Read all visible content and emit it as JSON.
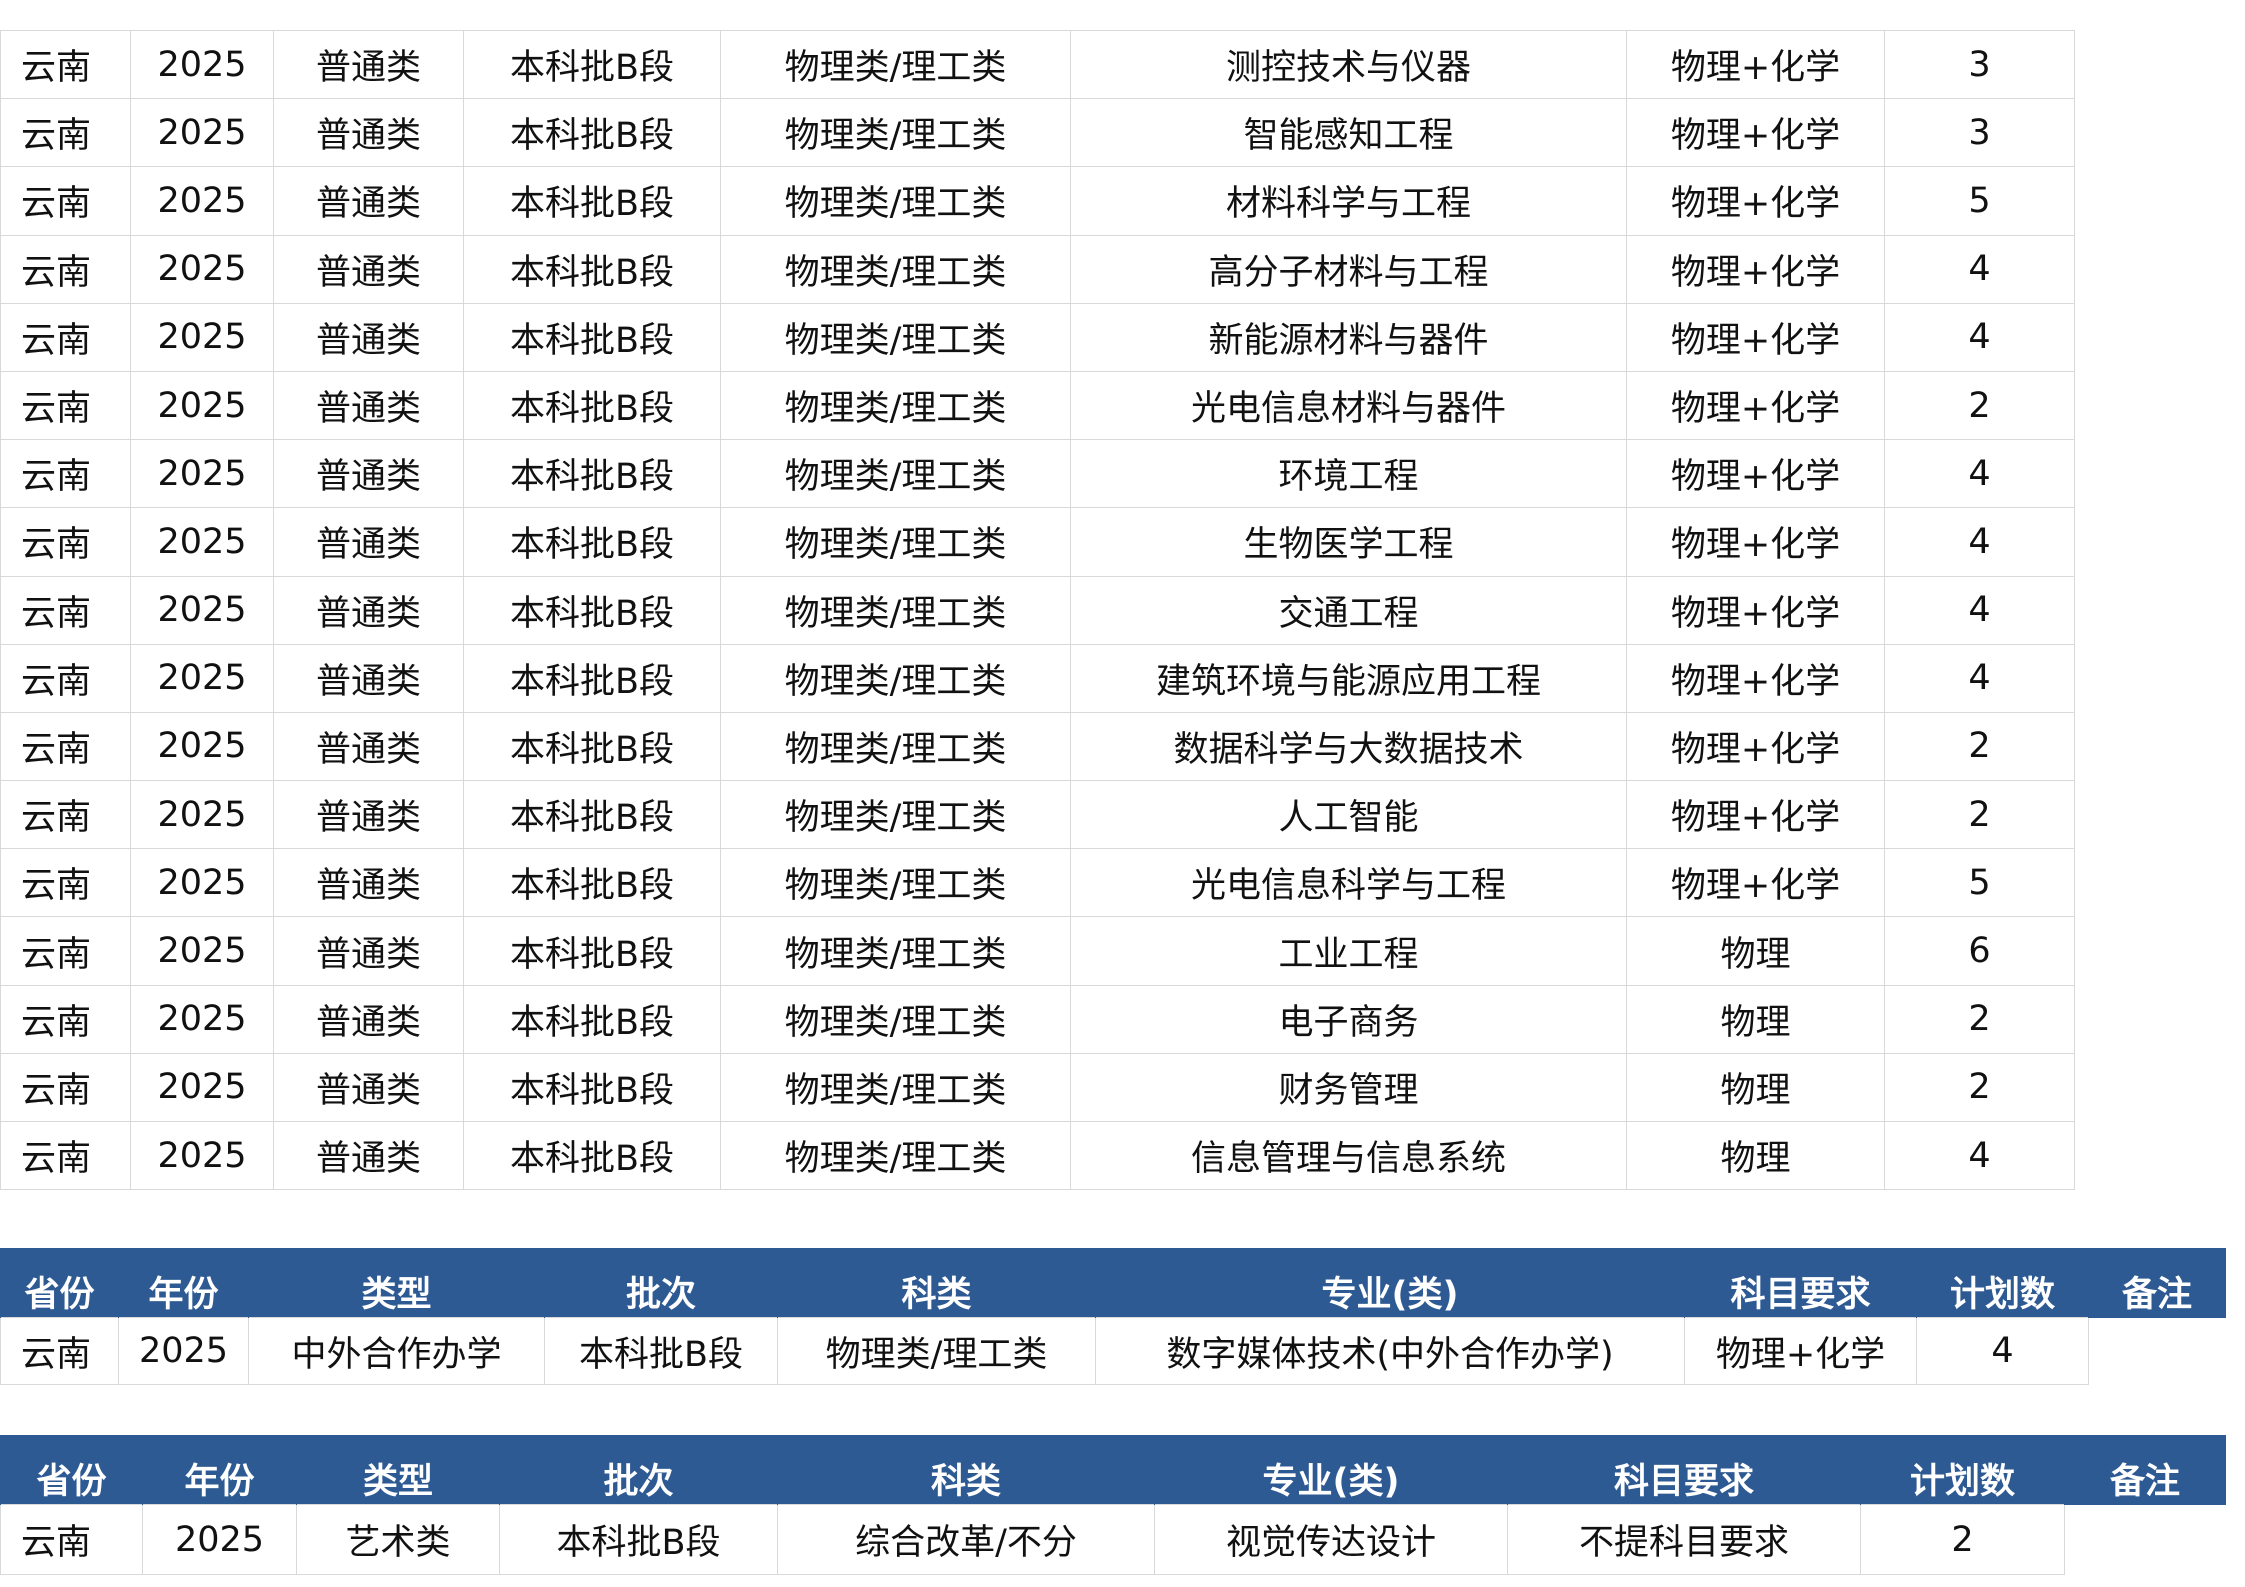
{
  "main_table": {
    "rows": [
      [
        "云南",
        "2025",
        "普通类",
        "本科批B段",
        "物理类/理工类",
        "测控技术与仪器",
        "物理+化学",
        "3"
      ],
      [
        "云南",
        "2025",
        "普通类",
        "本科批B段",
        "物理类/理工类",
        "智能感知工程",
        "物理+化学",
        "3"
      ],
      [
        "云南",
        "2025",
        "普通类",
        "本科批B段",
        "物理类/理工类",
        "材料科学与工程",
        "物理+化学",
        "5"
      ],
      [
        "云南",
        "2025",
        "普通类",
        "本科批B段",
        "物理类/理工类",
        "高分子材料与工程",
        "物理+化学",
        "4"
      ],
      [
        "云南",
        "2025",
        "普通类",
        "本科批B段",
        "物理类/理工类",
        "新能源材料与器件",
        "物理+化学",
        "4"
      ],
      [
        "云南",
        "2025",
        "普通类",
        "本科批B段",
        "物理类/理工类",
        "光电信息材料与器件",
        "物理+化学",
        "2"
      ],
      [
        "云南",
        "2025",
        "普通类",
        "本科批B段",
        "物理类/理工类",
        "环境工程",
        "物理+化学",
        "4"
      ],
      [
        "云南",
        "2025",
        "普通类",
        "本科批B段",
        "物理类/理工类",
        "生物医学工程",
        "物理+化学",
        "4"
      ],
      [
        "云南",
        "2025",
        "普通类",
        "本科批B段",
        "物理类/理工类",
        "交通工程",
        "物理+化学",
        "4"
      ],
      [
        "云南",
        "2025",
        "普通类",
        "本科批B段",
        "物理类/理工类",
        "建筑环境与能源应用工程",
        "物理+化学",
        "4"
      ],
      [
        "云南",
        "2025",
        "普通类",
        "本科批B段",
        "物理类/理工类",
        "数据科学与大数据技术",
        "物理+化学",
        "2"
      ],
      [
        "云南",
        "2025",
        "普通类",
        "本科批B段",
        "物理类/理工类",
        "人工智能",
        "物理+化学",
        "2"
      ],
      [
        "云南",
        "2025",
        "普通类",
        "本科批B段",
        "物理类/理工类",
        "光电信息科学与工程",
        "物理+化学",
        "5"
      ],
      [
        "云南",
        "2025",
        "普通类",
        "本科批B段",
        "物理类/理工类",
        "工业工程",
        "物理",
        "6"
      ],
      [
        "云南",
        "2025",
        "普通类",
        "本科批B段",
        "物理类/理工类",
        "电子商务",
        "物理",
        "2"
      ],
      [
        "云南",
        "2025",
        "普通类",
        "本科批B段",
        "物理类/理工类",
        "财务管理",
        "物理",
        "2"
      ],
      [
        "云南",
        "2025",
        "普通类",
        "本科批B段",
        "物理类/理工类",
        "信息管理与信息系统",
        "物理",
        "4"
      ]
    ]
  },
  "coop_table": {
    "headers": [
      "省份",
      "年份",
      "类型",
      "批次",
      "科类",
      "专业(类)",
      "科目要求",
      "计划数",
      "备注"
    ],
    "rows": [
      [
        "云南",
        "2025",
        "中外合作办学",
        "本科批B段",
        "物理类/理工类",
        "数字媒体技术(中外合作办学)",
        "物理+化学",
        "4"
      ]
    ]
  },
  "art_table": {
    "headers": [
      "省份",
      "年份",
      "类型",
      "批次",
      "科类",
      "专业(类)",
      "科目要求",
      "计划数",
      "备注"
    ],
    "rows": [
      [
        "云南",
        "2025",
        "艺术类",
        "本科批B段",
        "综合改革/不分",
        "视觉传达设计",
        "不提科目要求",
        "2"
      ]
    ]
  },
  "colors": {
    "header_bg": "#2e5a94",
    "header_text": "#ffffff",
    "grid": "#d9d9d9"
  }
}
